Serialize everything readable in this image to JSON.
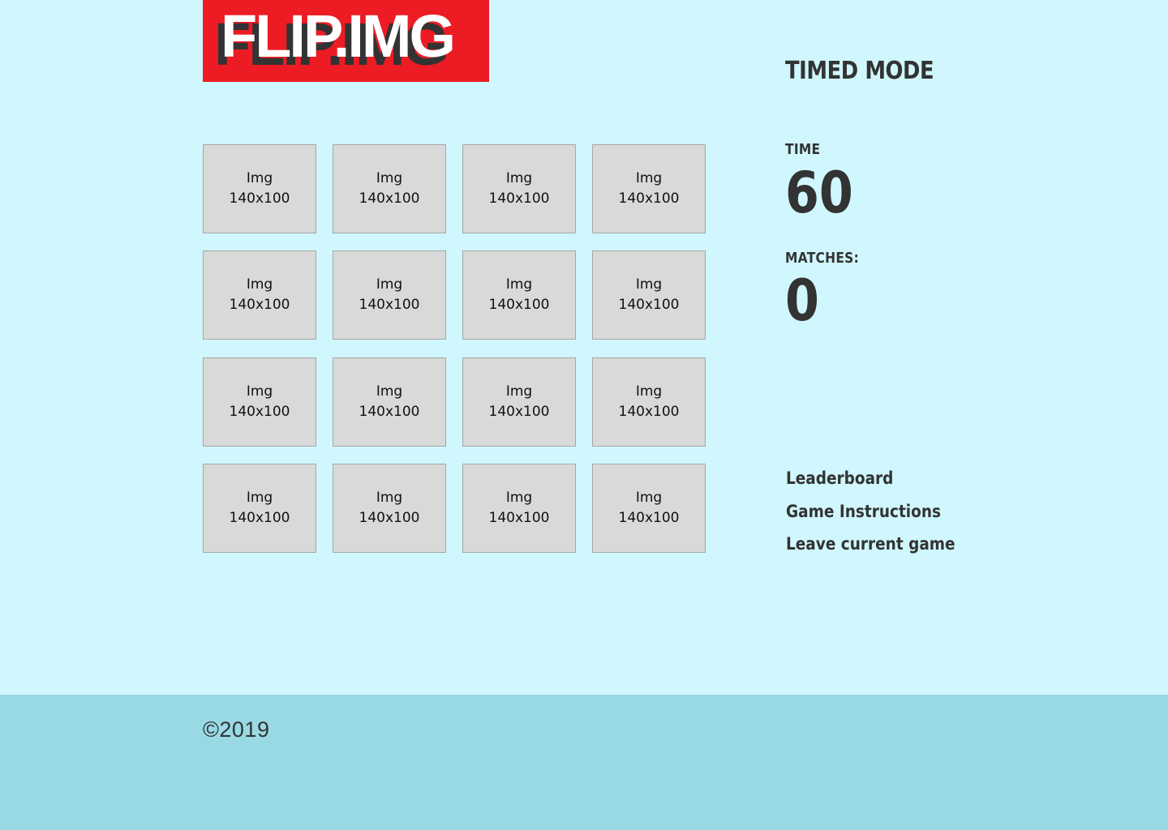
{
  "logo": {
    "text": "FLIP.IMG"
  },
  "mode_title": "TIMED MODE",
  "stats": {
    "time_label": "TIME",
    "time_value": "60",
    "matches_label": "MATCHES:",
    "matches_value": "0"
  },
  "tiles": [
    {
      "label": "Img",
      "size": "140x100"
    },
    {
      "label": "Img",
      "size": "140x100"
    },
    {
      "label": "Img",
      "size": "140x100"
    },
    {
      "label": "Img",
      "size": "140x100"
    },
    {
      "label": "Img",
      "size": "140x100"
    },
    {
      "label": "Img",
      "size": "140x100"
    },
    {
      "label": "Img",
      "size": "140x100"
    },
    {
      "label": "Img",
      "size": "140x100"
    },
    {
      "label": "Img",
      "size": "140x100"
    },
    {
      "label": "Img",
      "size": "140x100"
    },
    {
      "label": "Img",
      "size": "140x100"
    },
    {
      "label": "Img",
      "size": "140x100"
    },
    {
      "label": "Img",
      "size": "140x100"
    },
    {
      "label": "Img",
      "size": "140x100"
    },
    {
      "label": "Img",
      "size": "140x100"
    },
    {
      "label": "Img",
      "size": "140x100"
    }
  ],
  "links": {
    "leaderboard": "Leaderboard",
    "instructions": "Game Instructions",
    "leave": "Leave current game"
  },
  "footer": {
    "copyright": "©2019"
  },
  "colors": {
    "background": "#d0f7fd",
    "logo_bg": "#ed1c24",
    "footer_bg": "#98d9e4",
    "text": "#333333",
    "tile": "#d9d9d9"
  }
}
